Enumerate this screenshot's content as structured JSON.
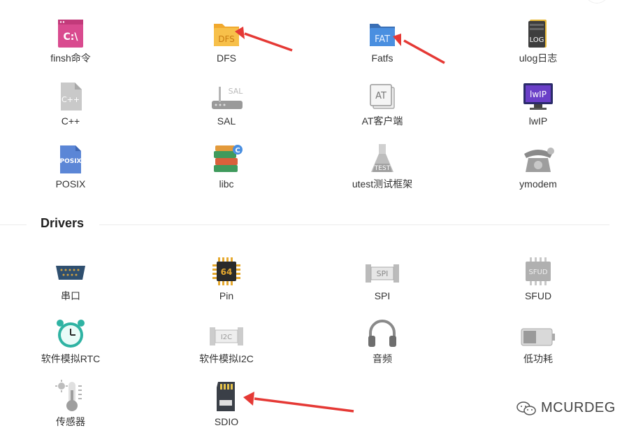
{
  "components": {
    "items": [
      {
        "label": "finsh命令",
        "icon": "terminal-icon",
        "badge": "C:\\"
      },
      {
        "label": "DFS",
        "icon": "folder-icon",
        "badge": "DFS"
      },
      {
        "label": "Fatfs",
        "icon": "fat-folder-icon",
        "badge": "FAT"
      },
      {
        "label": "ulog日志",
        "icon": "log-icon",
        "badge": "LOG"
      },
      {
        "label": "C++",
        "icon": "cpp-file-icon",
        "badge": "C++"
      },
      {
        "label": "SAL",
        "icon": "router-icon",
        "badge": "SAL"
      },
      {
        "label": "AT客户端",
        "icon": "at-icon",
        "badge": "AT"
      },
      {
        "label": "lwIP",
        "icon": "monitor-icon",
        "badge": "lwIP"
      },
      {
        "label": "POSIX",
        "icon": "posix-file-icon",
        "badge": "POSIX"
      },
      {
        "label": "libc",
        "icon": "books-icon",
        "badge": "C"
      },
      {
        "label": "utest测试框架",
        "icon": "flask-icon",
        "badge": "TEST"
      },
      {
        "label": "ymodem",
        "icon": "telephone-icon",
        "badge": ""
      }
    ]
  },
  "drivers": {
    "title": "Drivers",
    "items": [
      {
        "label": "串口",
        "icon": "serial-port-icon",
        "badge": ""
      },
      {
        "label": "Pin",
        "icon": "chip-icon",
        "badge": "64"
      },
      {
        "label": "SPI",
        "icon": "spi-icon",
        "badge": "SPI"
      },
      {
        "label": "SFUD",
        "icon": "sfud-chip-icon",
        "badge": "SFUD"
      },
      {
        "label": "软件模拟RTC",
        "icon": "alarm-clock-icon",
        "badge": ""
      },
      {
        "label": "软件模拟I2C",
        "icon": "i2c-icon",
        "badge": "I2C"
      },
      {
        "label": "音频",
        "icon": "headphones-icon",
        "badge": ""
      },
      {
        "label": "低功耗",
        "icon": "battery-icon",
        "badge": ""
      },
      {
        "label": "传感器",
        "icon": "thermometer-icon",
        "badge": ""
      },
      {
        "label": "SDIO",
        "icon": "sd-card-icon",
        "badge": ""
      }
    ]
  },
  "watermark": {
    "text": "MCURDEG",
    "icon": "wechat-icon"
  },
  "colors": {
    "arrow": "#e53935",
    "terminal": "#d94b8f",
    "folder": "#f7c04a",
    "fat": "#4a8fe0",
    "monitor": "#6a3fc8"
  }
}
